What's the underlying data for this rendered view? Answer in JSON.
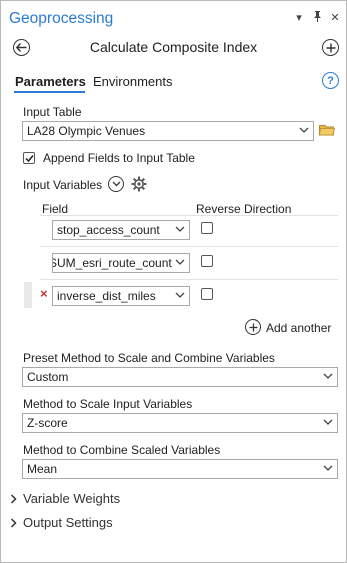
{
  "pane": {
    "title": "Geoprocessing",
    "pin_glyph": "▾ ⊥ ✕"
  },
  "tool": {
    "title": "Calculate Composite Index"
  },
  "tabs": [
    {
      "label": "Parameters",
      "active": true
    },
    {
      "label": "Environments",
      "active": false
    }
  ],
  "params": {
    "input_table_label": "Input Table",
    "input_table_value": "LA28 Olympic Venues",
    "append_fields_label": "Append Fields to Input Table",
    "append_fields_checked": true,
    "input_variables_label": "Input Variables",
    "field_header": "Field",
    "reverse_header": "Reverse Direction",
    "variables": [
      {
        "field": "stop_access_count",
        "reverse": false,
        "has_error": false
      },
      {
        "field": "SUM_esri_route_count",
        "reverse": false,
        "has_error": false
      },
      {
        "field": "inverse_dist_miles",
        "reverse": false,
        "has_error": true
      }
    ],
    "add_another_label": "Add another",
    "preset_label": "Preset Method to Scale and Combine Variables",
    "preset_value": "Custom",
    "scale_label": "Method to Scale Input Variables",
    "scale_value": "Z-score",
    "combine_label": "Method to Combine Scaled Variables",
    "combine_value": "Mean"
  },
  "sections": [
    {
      "label": "Variable Weights"
    },
    {
      "label": "Output Settings"
    }
  ],
  "colors": {
    "accent": "#2b7ad4",
    "error": "#c0392b"
  }
}
